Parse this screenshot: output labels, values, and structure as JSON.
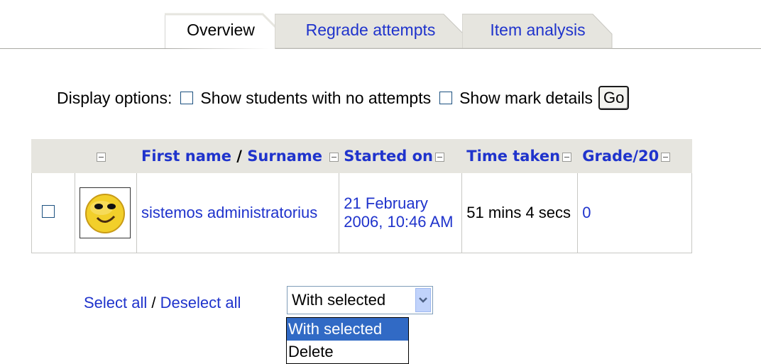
{
  "tabs": [
    {
      "label": "Overview",
      "active": true
    },
    {
      "label": "Regrade attempts",
      "active": false
    },
    {
      "label": "Item analysis",
      "active": false
    }
  ],
  "display_options": {
    "label": "Display options:",
    "show_no_attempts": "Show students with no attempts",
    "show_mark_details": "Show mark details",
    "go_label": "Go"
  },
  "table": {
    "headers": {
      "first_name": "First name",
      "separator": " / ",
      "surname": "Surname",
      "started_on": "Started on",
      "time_taken": "Time taken",
      "grade": "Grade/20"
    },
    "rows": [
      {
        "name": "sistemos administratorius",
        "started_on": "21 February 2006, 10:46 AM",
        "time_taken": "51 mins 4 secs",
        "grade": "0"
      }
    ]
  },
  "footer": {
    "select_all": "Select all",
    "slash": " / ",
    "deselect_all": "Deselect all",
    "with_selected_value": "With selected",
    "options": [
      "With selected",
      "Delete"
    ]
  },
  "colors": {
    "link": "#1f33cc",
    "header_bg": "#e6e5df",
    "selected_option_bg": "#316ac5"
  }
}
